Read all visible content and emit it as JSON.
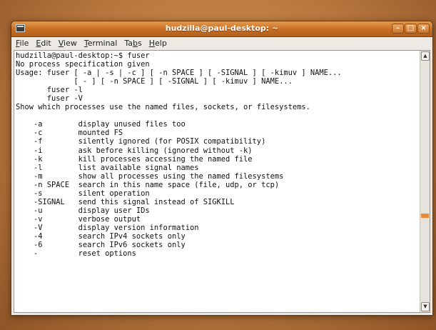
{
  "window": {
    "title": "hudzilla@paul-desktop: ~"
  },
  "menubar": [
    {
      "label": "File",
      "key": "F"
    },
    {
      "label": "Edit",
      "key": "E"
    },
    {
      "label": "View",
      "key": "V"
    },
    {
      "label": "Terminal",
      "key": "T"
    },
    {
      "label": "Tabs",
      "key": "b"
    },
    {
      "label": "Help",
      "key": "H"
    }
  ],
  "terminal": {
    "lines": [
      "hudzilla@paul-desktop:~$ fuser",
      "No process specification given",
      "Usage: fuser [ -a | -s | -c ] [ -n SPACE ] [ -SIGNAL ] [ -kimuv ] NAME...",
      "             [ - ] [ -n SPACE ] [ -SIGNAL ] [ -kimuv ] NAME...",
      "       fuser -l",
      "       fuser -V",
      "Show which processes use the named files, sockets, or filesystems.",
      "",
      "    -a        display unused files too",
      "    -c        mounted FS",
      "    -f        silently ignored (for POSIX compatibility)",
      "    -i        ask before killing (ignored without -k)",
      "    -k        kill processes accessing the named file",
      "    -l        list available signal names",
      "    -m        show all processes using the named filesystems",
      "    -n SPACE  search in this name space (file, udp, or tcp)",
      "    -s        silent operation",
      "    -SIGNAL   send this signal instead of SIGKILL",
      "    -u        display user IDs",
      "    -v        verbose output",
      "    -V        display version information",
      "    -4        search IPv4 sockets only",
      "    -6        search IPv6 sockets only",
      "    -         reset options"
    ]
  }
}
